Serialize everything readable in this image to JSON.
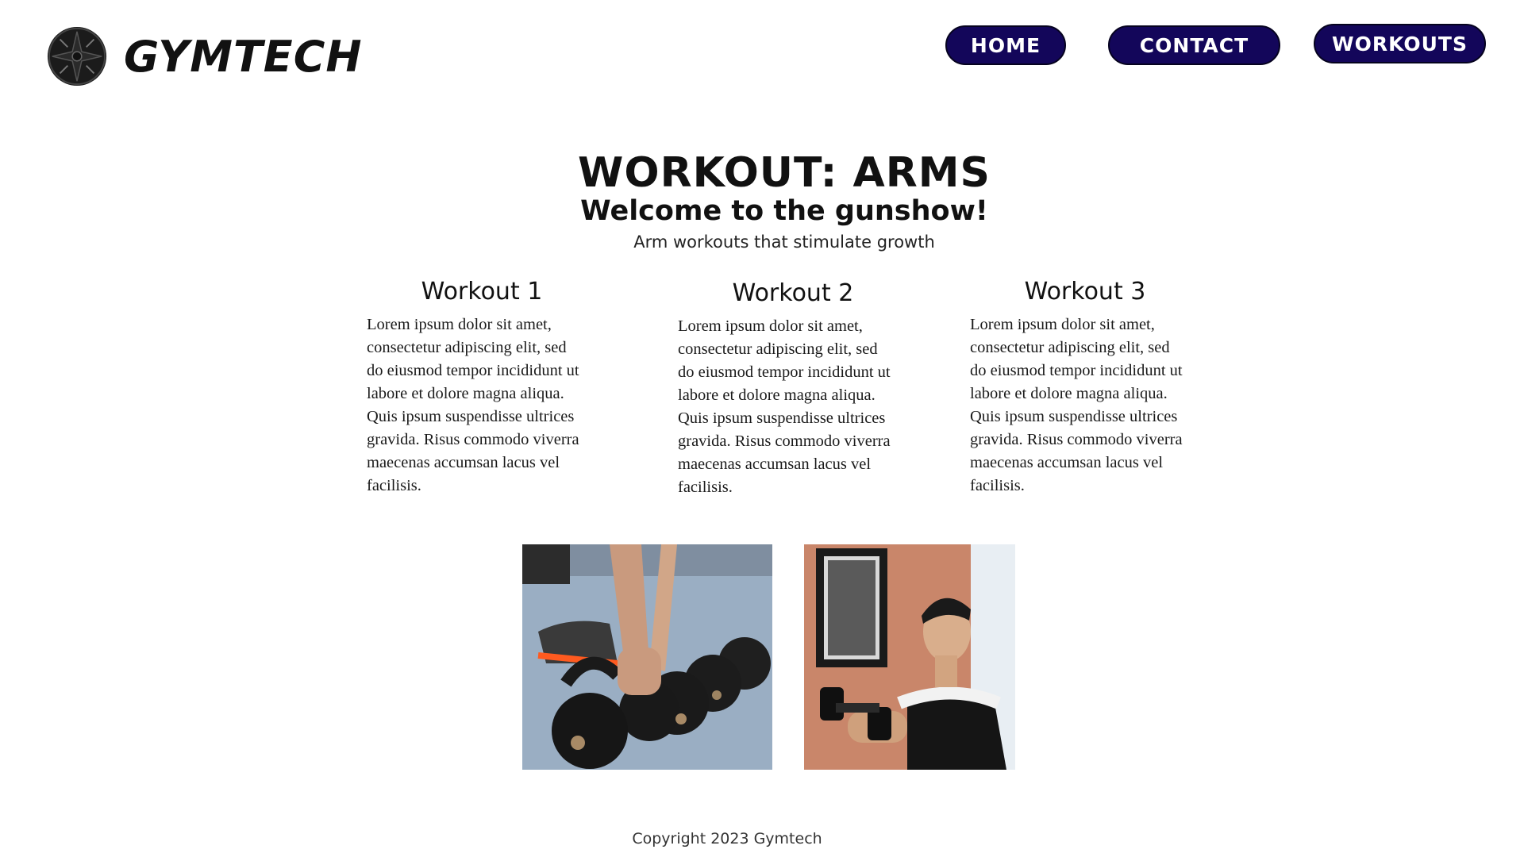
{
  "header": {
    "logo_icon": "dumbbell-plate-icon",
    "brand": "GYMTECH",
    "nav": {
      "home": "HOME",
      "contact": "CONTACT",
      "workouts": "WORKOUTS"
    },
    "nav_color": "#13065a"
  },
  "main": {
    "title": "WORKOUT: ARMS",
    "subtitle": "Welcome to the gunshow!",
    "tagline": "Arm workouts that stimulate growth",
    "workouts": [
      {
        "heading": "Workout 1",
        "body": "Lorem ipsum dolor sit amet, consectetur adipiscing elit, sed do eiusmod tempor incididunt ut labore et dolore magna aliqua. Quis ipsum suspendisse ultrices gravida. Risus commodo viverra maecenas accumsan lacus vel facilisis."
      },
      {
        "heading": "Workout 2",
        "body": "Lorem ipsum dolor sit amet, consectetur adipiscing elit, sed do eiusmod tempor incididunt ut labore et dolore magna aliqua. Quis ipsum suspendisse ultrices gravida. Risus commodo viverra maecenas accumsan lacus vel facilisis."
      },
      {
        "heading": "Workout 3",
        "body": "Lorem ipsum dolor sit amet, consectetur adipiscing elit, sed do eiusmod tempor incididunt ut labore et dolore magna aliqua. Quis ipsum suspendisse ultrices gravida. Risus commodo viverra maecenas accumsan lacus vel facilisis."
      }
    ]
  },
  "footer": {
    "copyright": "Copyright 2023 Gymtech"
  }
}
